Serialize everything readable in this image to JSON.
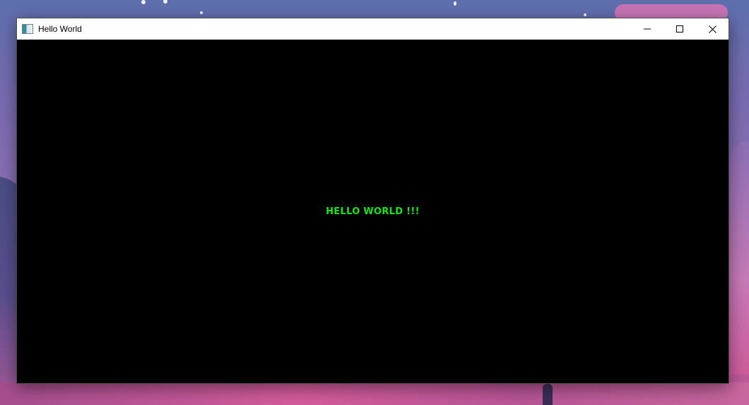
{
  "window": {
    "title": "Hello World",
    "icon": "app-window-icon",
    "buttons": [
      "minimize-icon",
      "maximize-icon",
      "close-icon"
    ]
  },
  "content": {
    "message": "HELLO WORLD !!!",
    "message_color": "#19e619",
    "background": "#000000"
  }
}
